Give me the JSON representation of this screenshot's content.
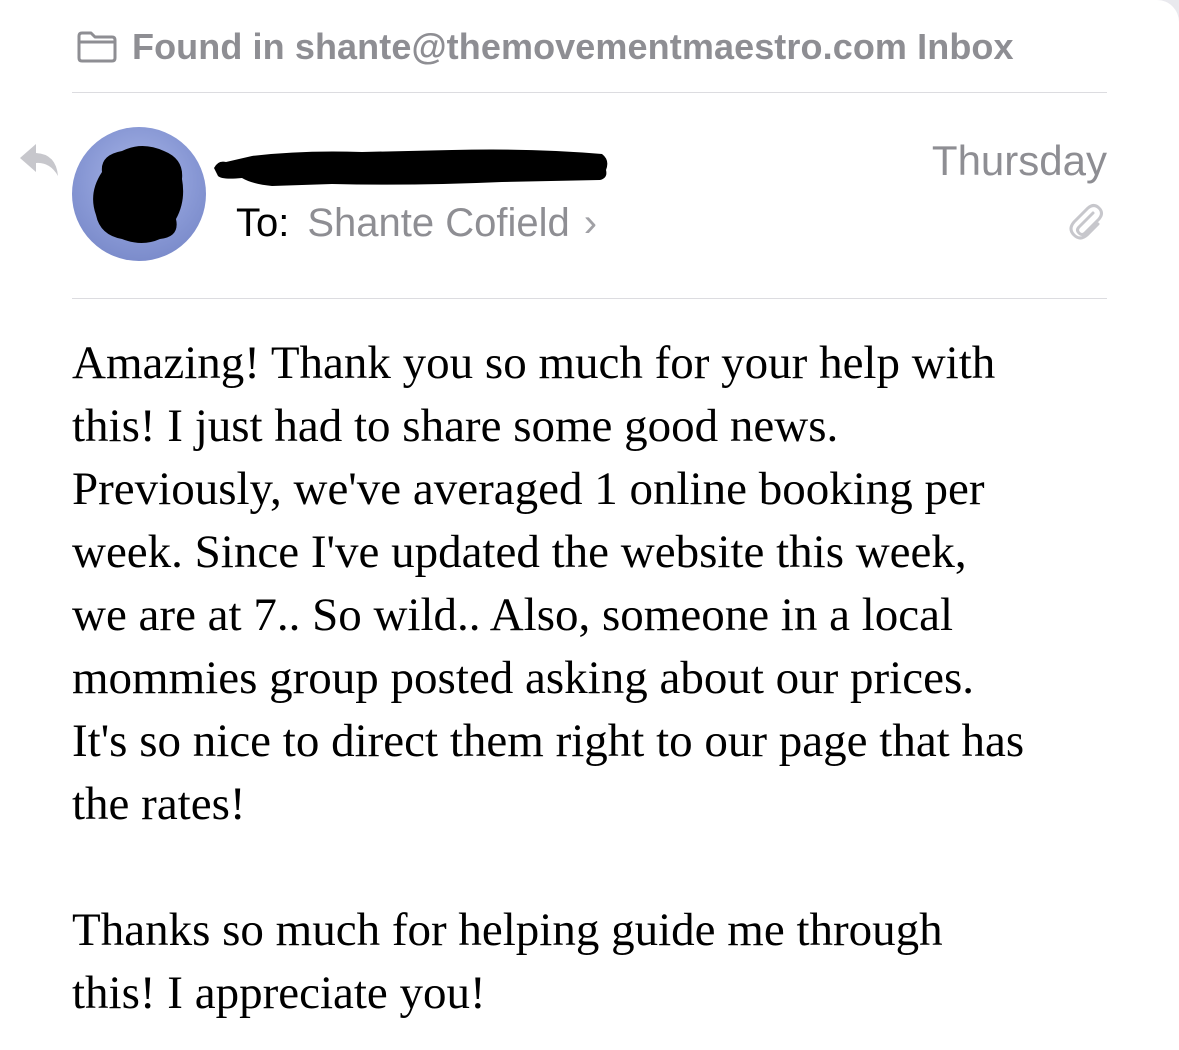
{
  "header": {
    "found_in": "Found in shante@themovementmaestro.com Inbox",
    "folder_icon": "folder-icon"
  },
  "message": {
    "to_label": "To:",
    "to_name": "Shante Cofield",
    "chevron": "›",
    "date": "Thursday",
    "reply_icon": "reply-icon",
    "attachment_icon": "paperclip-icon",
    "body_lines_p1": [
      "Amazing! Thank you so much for your help with",
      "this! I just had to share some good news.",
      "Previously, we've averaged 1 online booking per",
      "week. Since I've updated the website this week,",
      "we are at 7.. So wild.. Also, someone in a local",
      "mommies group posted asking about our prices.",
      "It's so nice to direct them right to our page that has",
      "the rates!"
    ],
    "body_lines_p2": [
      "Thanks so much for helping guide me through",
      "this! I appreciate you!"
    ]
  },
  "colors": {
    "secondary_text": "#8e8e93",
    "divider": "#dcdce0",
    "avatar": "#8797d4"
  }
}
